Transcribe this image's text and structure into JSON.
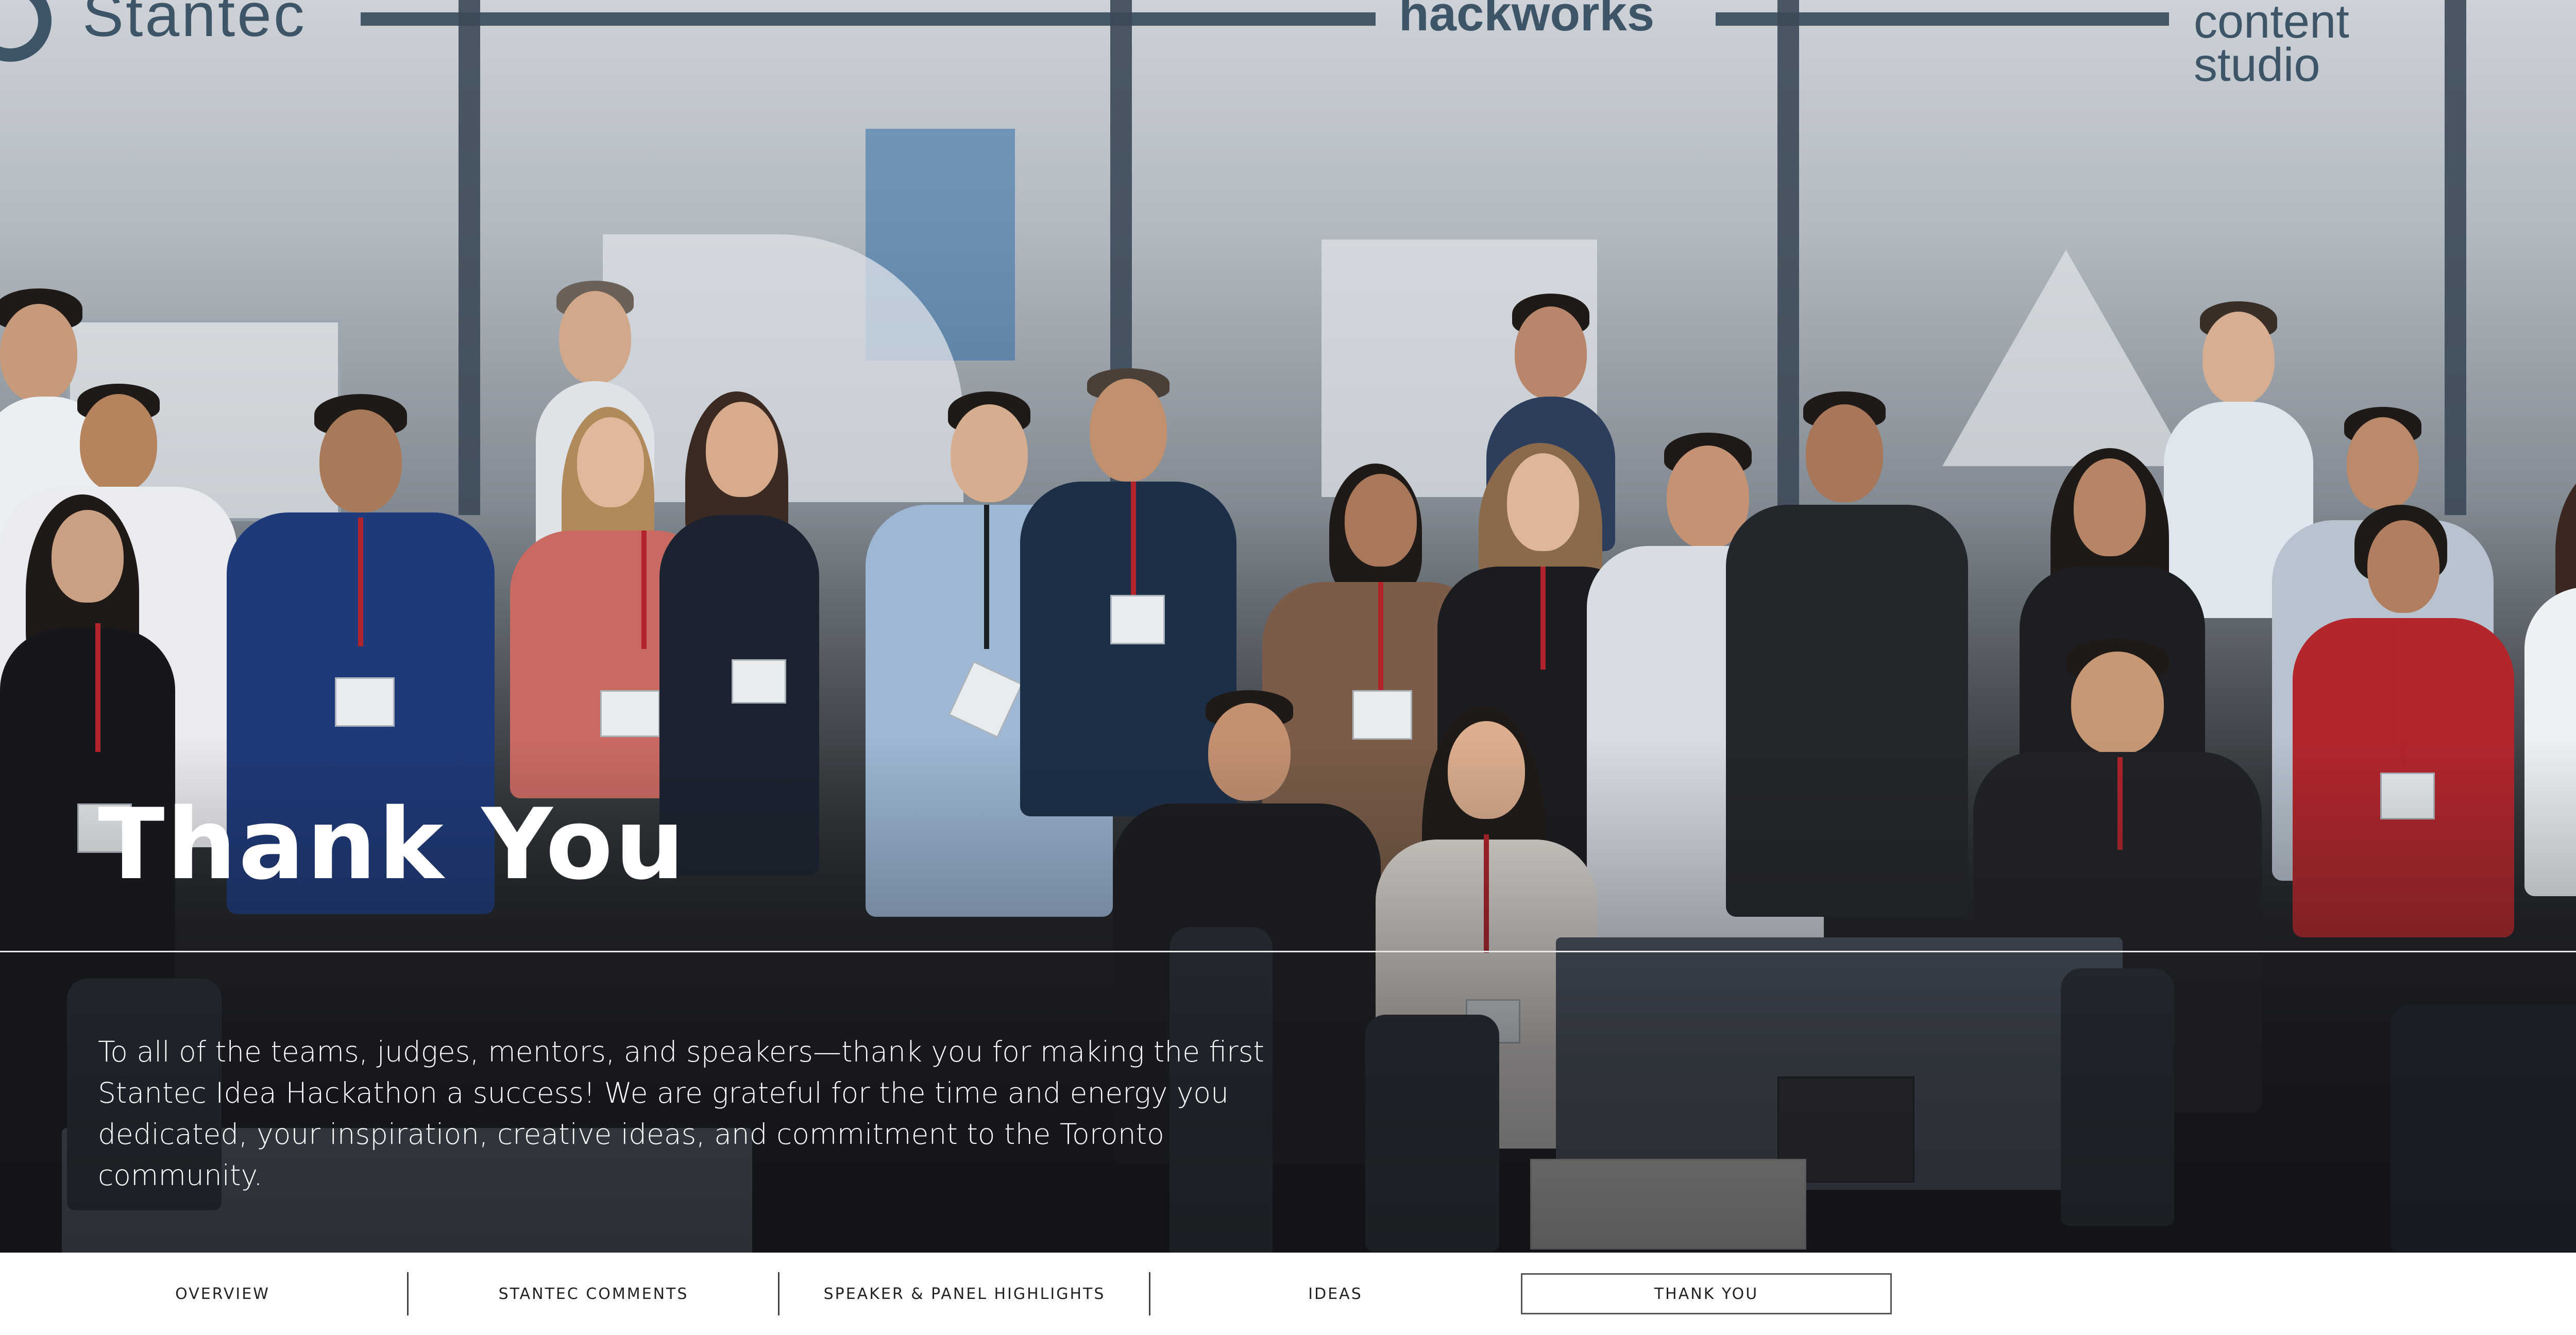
{
  "hero": {
    "logos": {
      "left": "Stantec",
      "center": "hackworks",
      "right_line1": "content",
      "right_line2": "studio"
    },
    "title": "Thank You",
    "body": "To all of the teams, judges, mentors, and speakers—thank you for making the first Stantec Idea Hackathon a success! We are grateful for the time and energy you dedicated, your inspiration, creative ideas, and commitment to the Toronto community."
  },
  "nav": {
    "items": [
      {
        "label": "OVERVIEW",
        "active": false
      },
      {
        "label": "STANTEC COMMENTS",
        "active": false
      },
      {
        "label": "SPEAKER & PANEL HIGHLIGHTS",
        "active": false
      },
      {
        "label": "IDEAS",
        "active": false
      },
      {
        "label": "THANK YOU",
        "active": true
      }
    ]
  },
  "colors": {
    "logo": "#3d5567",
    "title_text": "#ffffff",
    "nav_text": "#222222",
    "nav_active_border": "#555555"
  }
}
